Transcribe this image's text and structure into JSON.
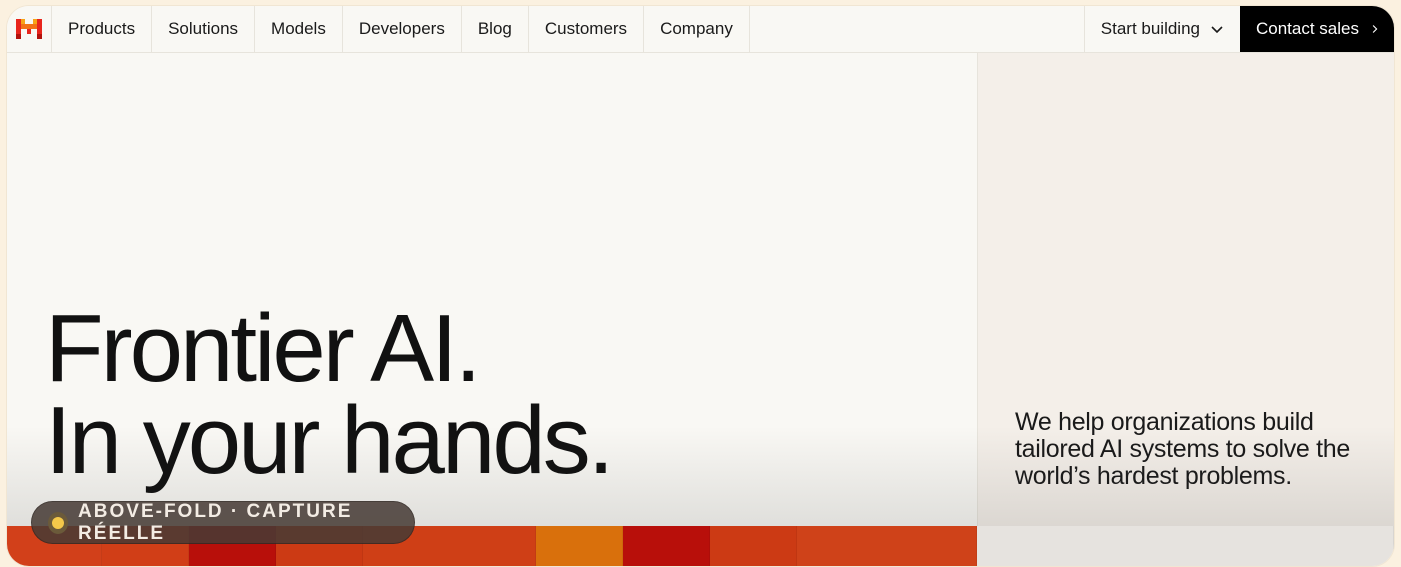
{
  "nav": {
    "logo_name": "M",
    "items": [
      "Products",
      "Solutions",
      "Models",
      "Developers",
      "Blog",
      "Customers",
      "Company"
    ],
    "start_building": "Start building",
    "contact_sales": "Contact sales"
  },
  "hero": {
    "headline": "Frontier AI.\nIn your hands.",
    "tagline": "We help organizations build tailored AI systems to solve the world’s hardest problems."
  },
  "badge": {
    "text": "ABOVE-FOLD · CAPTURE RÉELLE"
  },
  "colors": {
    "accent_black": "#000000",
    "strip": [
      "#d2401a",
      "#d13e17",
      "#b80f0a",
      "#cc3a14",
      "#cf3f16",
      "#d9700c",
      "#b80f0a",
      "#cc3a14",
      "#cf4219",
      "#e6e3df"
    ]
  }
}
